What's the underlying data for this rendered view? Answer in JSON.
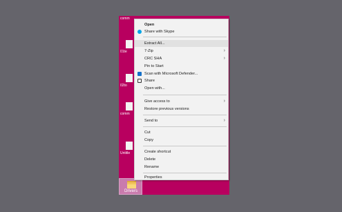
{
  "desktop": {
    "icons": [
      {
        "label": "comm"
      },
      {
        "label": "01te"
      },
      {
        "label": "02to"
      },
      {
        "label": "comm"
      },
      {
        "label": "Untitle"
      }
    ],
    "selected_item": {
      "label": "Drivers"
    }
  },
  "context_menu": {
    "items": [
      {
        "label": "Open",
        "bold": true
      },
      {
        "label": "Share with Skype",
        "icon": "skype-icon"
      },
      {
        "label": "Extract All...",
        "hover": true
      },
      {
        "label": "7-Zip",
        "submenu": true
      },
      {
        "label": "CRC SHA",
        "submenu": true
      },
      {
        "label": "Pin to Start"
      },
      {
        "label": "Scan with Microsoft Defender...",
        "icon": "defender-shield-icon"
      },
      {
        "label": "Share",
        "icon": "share-icon"
      },
      {
        "label": "Open with..."
      },
      {
        "label": "Give access to",
        "submenu": true
      },
      {
        "label": "Restore previous versions"
      },
      {
        "label": "Send to",
        "submenu": true
      },
      {
        "label": "Cut"
      },
      {
        "label": "Copy"
      },
      {
        "label": "Create shortcut"
      },
      {
        "label": "Delete"
      },
      {
        "label": "Rename"
      },
      {
        "label": "Properties"
      }
    ],
    "submenu_arrow": "›"
  },
  "colors": {
    "background": "#65646b",
    "desktop": "#b8005f",
    "menu": "#f2f2f2",
    "hover": "#e1e1e1"
  }
}
